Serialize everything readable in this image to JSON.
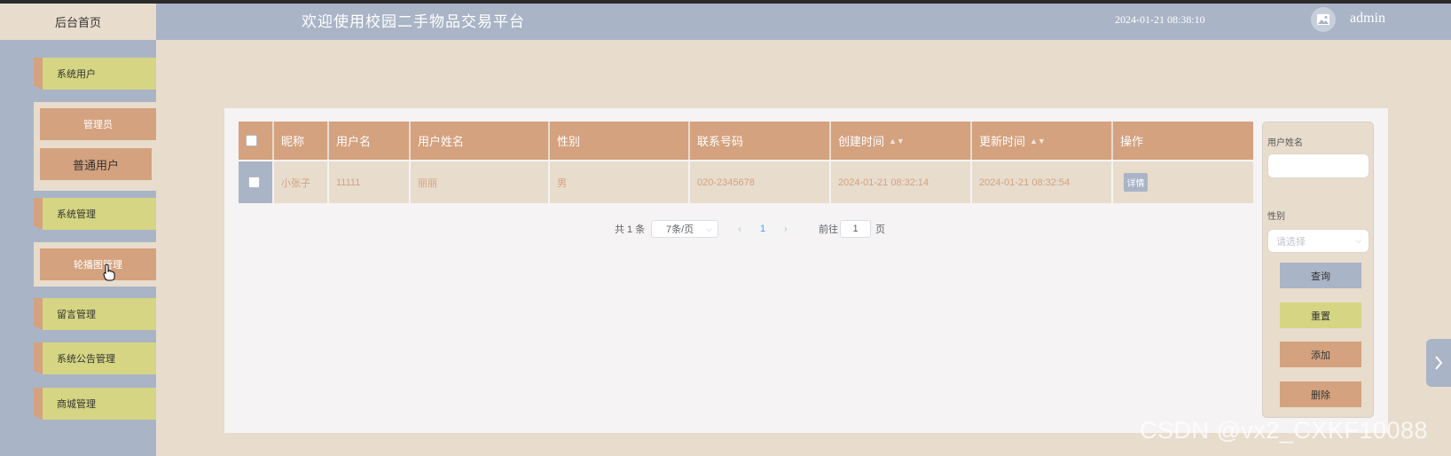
{
  "header": {
    "home_label": "后台首页",
    "site_title": "欢迎使用校园二手物品交易平台",
    "datetime": "2024-01-21 08:38:10",
    "avatar_icon": "image-icon",
    "username": "admin"
  },
  "sidebar": {
    "items": [
      {
        "label": "系统用户",
        "sub": [
          "管理员",
          "普通用户"
        ]
      },
      {
        "label": "系统管理",
        "sub": [
          "轮播图管理"
        ]
      },
      {
        "label": "留言管理"
      },
      {
        "label": "系统公告管理"
      },
      {
        "label": "商城管理"
      }
    ]
  },
  "table": {
    "columns": [
      "昵称",
      "用户名",
      "用户姓名",
      "性别",
      "联系号码",
      "创建时间",
      "更新时间",
      "操作"
    ],
    "rows": [
      {
        "nickname": "小张子",
        "username": "11111",
        "realname": "丽丽",
        "gender": "男",
        "phone": "020-2345678",
        "created": "2024-01-21 08:32:14",
        "updated": "2024-01-21 08:32:54",
        "action": "详情"
      }
    ]
  },
  "pagination": {
    "total": "共 1 条",
    "page_size": "7条/页",
    "current_page": "1",
    "goto_prefix": "前往",
    "goto_value": "1",
    "goto_suffix": "页"
  },
  "search": {
    "name_label": "用户姓名",
    "gender_label": "性别",
    "gender_placeholder": "请选择",
    "query_btn": "查询",
    "reset_btn": "重置",
    "add_btn": "添加",
    "delete_btn": "删除"
  },
  "watermark": "CSDN @vx2_CXKF10088",
  "colors": {
    "header": "#a9b4c6",
    "accent": "#d4a27f",
    "menu_yellow": "#d5d583",
    "background": "#e8dccd"
  }
}
